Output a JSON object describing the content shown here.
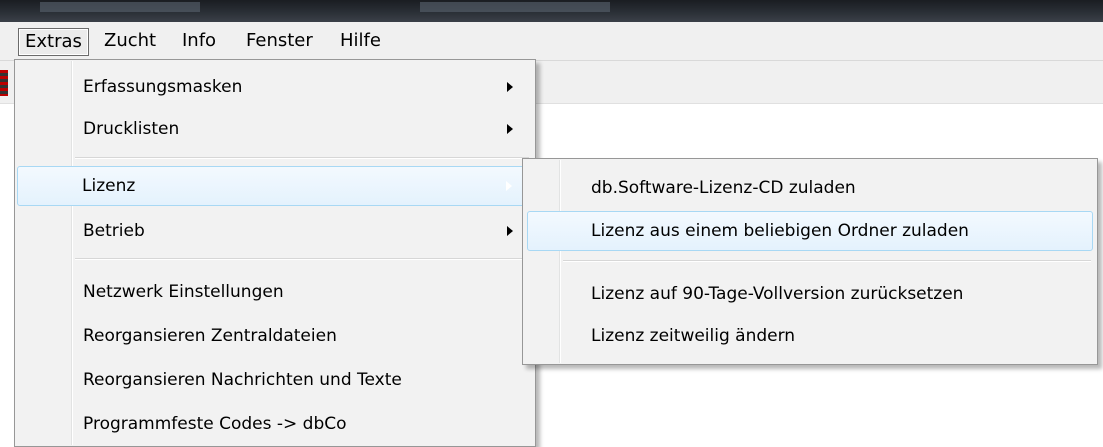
{
  "menubar": {
    "items": [
      {
        "label": "Extras"
      },
      {
        "label": "Zucht"
      },
      {
        "label": "Info"
      },
      {
        "label": "Fenster"
      },
      {
        "label": "Hilfe"
      }
    ]
  },
  "extras_menu": {
    "items": [
      {
        "label": "Erfassungsmasken"
      },
      {
        "label": "Drucklisten"
      },
      {
        "label": "Lizenz"
      },
      {
        "label": "Betrieb"
      },
      {
        "label": "Netzwerk Einstellungen"
      },
      {
        "label": "Reorgansieren Zentraldateien"
      },
      {
        "label": "Reorgansieren Nachrichten und Texte"
      },
      {
        "label": "Programmfeste Codes -> dbCo"
      }
    ]
  },
  "lizenz_submenu": {
    "items": [
      {
        "label": "db.Software-Lizenz-CD zuladen"
      },
      {
        "label": "Lizenz aus einem beliebigen Ordner zuladen"
      },
      {
        "label": "Lizenz auf 90-Tage-Vollversion zurücksetzen"
      },
      {
        "label": "Lizenz zeitweilig ändern"
      }
    ]
  },
  "colors": {
    "menu_bg": "#f2f2f2",
    "hover_border": "#a8d8f4",
    "hover_fill": "#e4f2fd"
  }
}
